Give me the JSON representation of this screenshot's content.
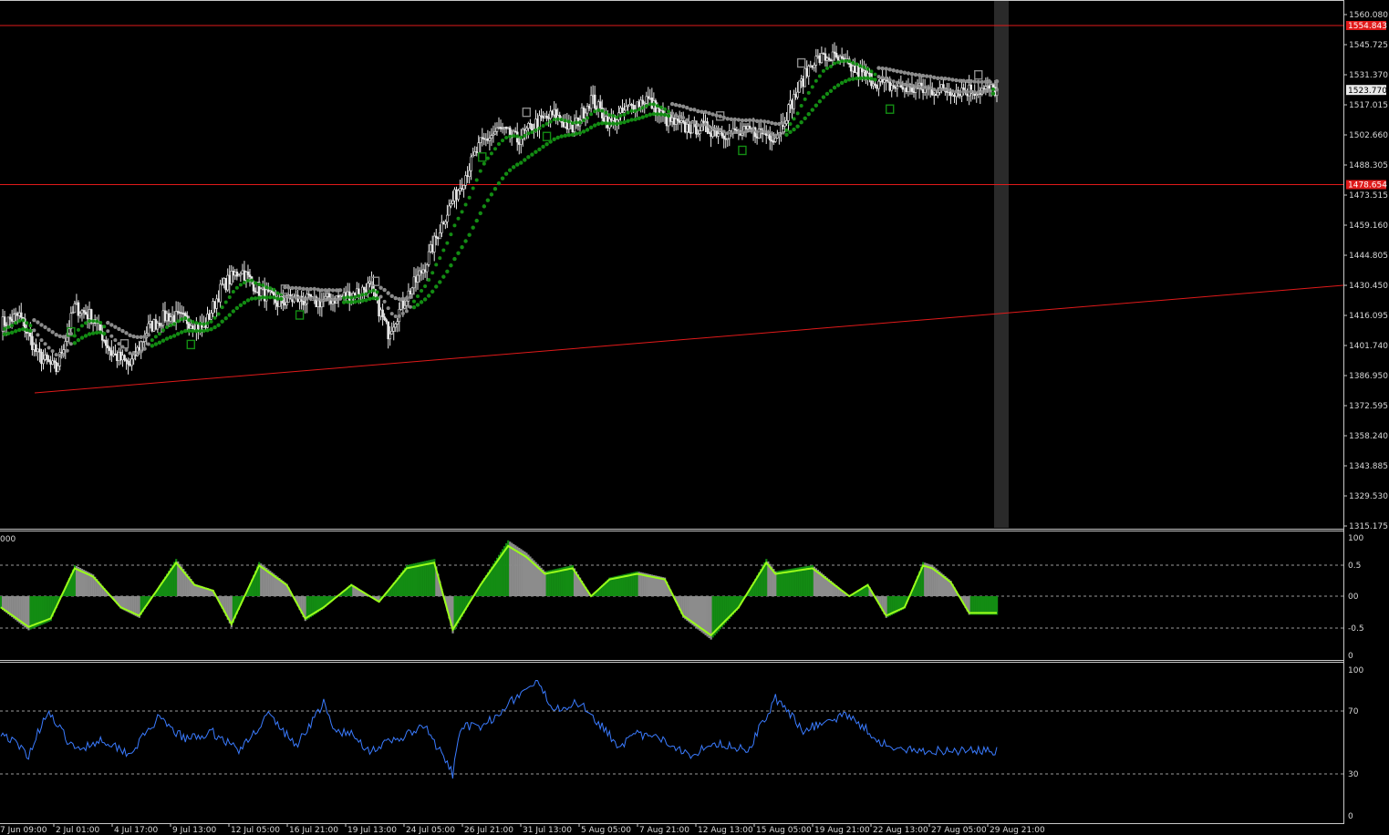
{
  "colors": {
    "background": "#000000",
    "grid_frame": "#c8c8c8",
    "candle": "#e8e8e8",
    "trend_up": "#138c13",
    "trend_flat": "#8c8c8c",
    "histogram_up": "#138c13",
    "histogram_down": "#8c8c8c",
    "signal_line": "#9aff1a",
    "rsi_line": "#3a7bff",
    "horizontal_level": "#e01a1a",
    "price_tag_bg": "#e01a1a",
    "current_price_bg": "#e8e8e8",
    "cursor_band": "#2a2a2a"
  },
  "main_panel": {
    "price_scale": [
      "1560.080",
      "1545.725",
      "1531.370",
      "1517.015",
      "1502.660",
      "1488.305",
      "1473.515",
      "1459.160",
      "1444.805",
      "1430.450",
      "1416.095",
      "1401.740",
      "1386.950",
      "1372.595",
      "1358.240",
      "1343.885",
      "1329.530",
      "1315.175"
    ],
    "resistance_level": "1554.843",
    "support_level": "1478.654",
    "current_price": "1523.770"
  },
  "oscillator_panel": {
    "left_label": "000",
    "scale": [
      "100",
      "0.5",
      "00",
      "-0.5",
      "0"
    ]
  },
  "rsi_panel": {
    "scale": [
      "100",
      "70",
      "30",
      "0"
    ]
  },
  "time_axis": [
    "7 Jun 09:00",
    "2 Jul 01:00",
    "4 Jul 17:00",
    "9 Jul 13:00",
    "12 Jul 05:00",
    "16 Jul 21:00",
    "19 Jul 13:00",
    "24 Jul 05:00",
    "26 Jul 21:00",
    "31 Jul 13:00",
    "5 Aug 05:00",
    "7 Aug 21:00",
    "12 Aug 13:00",
    "15 Aug 05:00",
    "19 Aug 21:00",
    "22 Aug 13:00",
    "27 Aug 05:00",
    "29 Aug 21:00"
  ],
  "chart_data": {
    "type": "line",
    "price": {
      "anchors_x_bar": [
        0,
        10,
        20,
        30,
        40,
        50,
        60,
        70,
        80,
        90,
        100,
        110,
        120,
        130,
        140,
        150,
        160,
        170,
        180,
        190,
        200,
        210,
        220,
        230,
        240,
        250,
        260,
        270,
        280,
        290,
        300,
        310,
        320,
        330,
        340,
        350,
        360,
        370,
        380,
        390,
        400,
        410,
        420,
        430,
        440,
        450,
        460,
        470,
        480,
        490,
        500,
        510,
        520,
        530,
        540
      ],
      "anchors_close": [
        1412,
        1416,
        1397,
        1390,
        1420,
        1415,
        1398,
        1392,
        1410,
        1416,
        1414,
        1410,
        1430,
        1438,
        1428,
        1422,
        1424,
        1422,
        1424,
        1426,
        1430,
        1408,
        1425,
        1440,
        1462,
        1480,
        1498,
        1505,
        1500,
        1508,
        1512,
        1505,
        1520,
        1508,
        1515,
        1520,
        1510,
        1506,
        1506,
        1504,
        1503,
        1504,
        1502,
        1520,
        1538,
        1540,
        1535,
        1530,
        1526,
        1525,
        1524,
        1524,
        1524,
        1524,
        1524
      ],
      "last_bar_index": 540
    },
    "oscillator": {
      "ylim": [
        -1,
        1
      ],
      "anchors_x_bar": [
        0,
        15,
        27,
        40,
        50,
        65,
        75,
        95,
        105,
        115,
        125,
        140,
        155,
        165,
        175,
        190,
        205,
        220,
        235,
        245,
        260,
        275,
        285,
        295,
        310,
        320,
        330,
        345,
        360,
        370,
        385,
        400,
        415,
        420,
        440,
        460,
        470,
        480,
        490,
        500,
        505,
        515,
        525,
        540
      ],
      "anchors_value": [
        -0.2,
        -0.55,
        -0.4,
        0.5,
        0.35,
        -0.2,
        -0.35,
        0.6,
        0.2,
        0.1,
        -0.5,
        0.55,
        0.2,
        -0.4,
        -0.2,
        0.2,
        -0.1,
        0.5,
        0.6,
        -0.6,
        0.2,
        0.9,
        0.7,
        0.4,
        0.5,
        0.0,
        0.3,
        0.4,
        0.3,
        -0.35,
        -0.7,
        -0.2,
        0.6,
        0.4,
        0.5,
        0.0,
        0.2,
        -0.35,
        -0.2,
        0.55,
        0.5,
        0.25,
        -0.3,
        -0.3
      ]
    },
    "rsi": {
      "ylim": [
        0,
        100
      ],
      "anchors_x_bar": [
        0,
        15,
        25,
        40,
        55,
        70,
        85,
        100,
        115,
        130,
        145,
        160,
        175,
        180,
        190,
        200,
        215,
        230,
        245,
        250,
        260,
        275,
        290,
        300,
        315,
        335,
        345,
        355,
        365,
        375,
        385,
        395,
        405,
        420,
        435,
        445,
        460,
        475,
        485,
        495,
        505,
        515,
        525,
        530,
        540
      ],
      "anchors_value": [
        57,
        42,
        70,
        45,
        52,
        43,
        65,
        52,
        56,
        45,
        68,
        48,
        75,
        58,
        55,
        45,
        52,
        60,
        30,
        62,
        58,
        75,
        88,
        72,
        75,
        48,
        55,
        53,
        48,
        42,
        50,
        48,
        45,
        78,
        58,
        62,
        68,
        52,
        45,
        45,
        45,
        45,
        45,
        45,
        45
      ]
    }
  }
}
